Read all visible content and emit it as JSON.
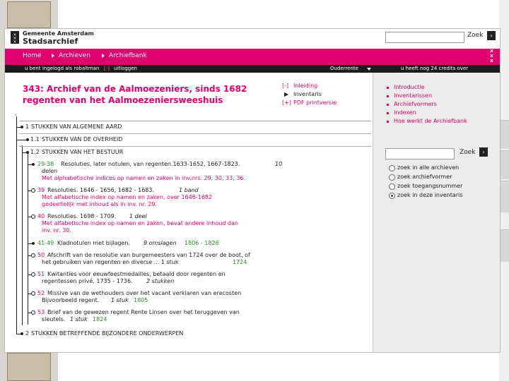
{
  "header": {
    "org": "Gemeente Amsterdam",
    "name": "Stadsarchief",
    "search_button": "Zoek",
    "go_icon": "›",
    "close_icon": "x"
  },
  "nav": {
    "items": [
      "Home",
      "Archieven",
      "Archiefbank"
    ]
  },
  "subbar": {
    "logged_in": "u bent ingelogd als robaltman",
    "logout": "uitloggen",
    "selector": "Ouderrente",
    "credits": "u heeft nog 24 credits over"
  },
  "archive": {
    "title_line1": "343: Archief van de Aalmoezeniers, sinds 1682",
    "title_line2": "regenten van het Aalmoezeniersweeshuis"
  },
  "view_options": [
    {
      "marker": "[-]",
      "label": "Inleiding"
    },
    {
      "marker": "▶",
      "label": "Inventaris"
    },
    {
      "marker": "[+]",
      "label": "PDF printversie"
    }
  ],
  "side_menu": [
    "Introductie",
    "Inventarissen",
    "Archiefvormers",
    "Indexen",
    "Hoe werkt de Archiefbank"
  ],
  "side_search": {
    "button": "Zoek",
    "options": [
      {
        "label": "zoek in alle archieven",
        "selected": false
      },
      {
        "label": "zoek archiefvormer",
        "selected": false
      },
      {
        "label": "zoek toegangsnummer",
        "selected": false
      },
      {
        "label": "zoek in deze inventaris",
        "selected": true
      }
    ]
  },
  "tree": {
    "top_marker": "-",
    "sections": [
      {
        "num": "1",
        "label": "STUKKEN VAN ALGEMENE AARD"
      },
      {
        "num": "1.1",
        "label": "STUKKEN VAN DE OVERHEID"
      },
      {
        "num": "1.2",
        "label": "STUKKEN VAN HET BESTUUR"
      }
    ],
    "entries": [
      {
        "id": "29-38",
        "text": "Resoluties, later notulen, van regenten.1633-1652, 1667-1823.",
        "note": "10",
        "line2": "delen",
        "line3": "Met alphabetische indices op namen en zaken in inv.nrs. 29, 30, 33, 36."
      },
      {
        "id": "39",
        "text": "Resoluties. 1646 - 1656, 1682 - 1683.",
        "note": "1 band",
        "line2": "Met alfabetische index op namen en zaken, over 1646-1682",
        "line3": "gedeeltelijk met inhoud als in inv. nr. 29."
      },
      {
        "id": "40",
        "text": "Resoluties. 1698 - 1709.",
        "note": "1 deel",
        "line2": "Met alfabetische index op namen en zaken, bevat andere inhoud dan",
        "line3": "inv. nr. 30."
      },
      {
        "id": "41-49",
        "text": "Kladnotulen met bijlagen.",
        "note": "9 omslagen",
        "years": "1806 - 1826"
      },
      {
        "id": "50",
        "text": "Afschrift van de resolutie van burgemeesters van 1724 over de boot, of",
        "line2": "het gebruiken van regenten en diverse ... 1 stuk",
        "years": "1724"
      },
      {
        "id": "51",
        "text": "Kwitanties voor eeuwfeestmedailles, betaald door regenten en",
        "line2": "regentessen privé. 1735 - 1736.",
        "note": "2 stukken"
      },
      {
        "id": "52",
        "text": "Missive van de wethouders over het vacant verklaren van erecosten",
        "line2": "Bijvoorbeeld regent.",
        "note": "1 stuk",
        "years": "1805"
      },
      {
        "id": "53",
        "text": "Brief van de gewezen regent Rente Linsen over het teruggeven van",
        "line2": "sleutels.",
        "note": "1 stuk",
        "years": "1824"
      }
    ],
    "last_section": {
      "num": "2",
      "label": "STUKKEN BETREFFENDE BIJZONDERE ONDERWERPEN"
    }
  }
}
